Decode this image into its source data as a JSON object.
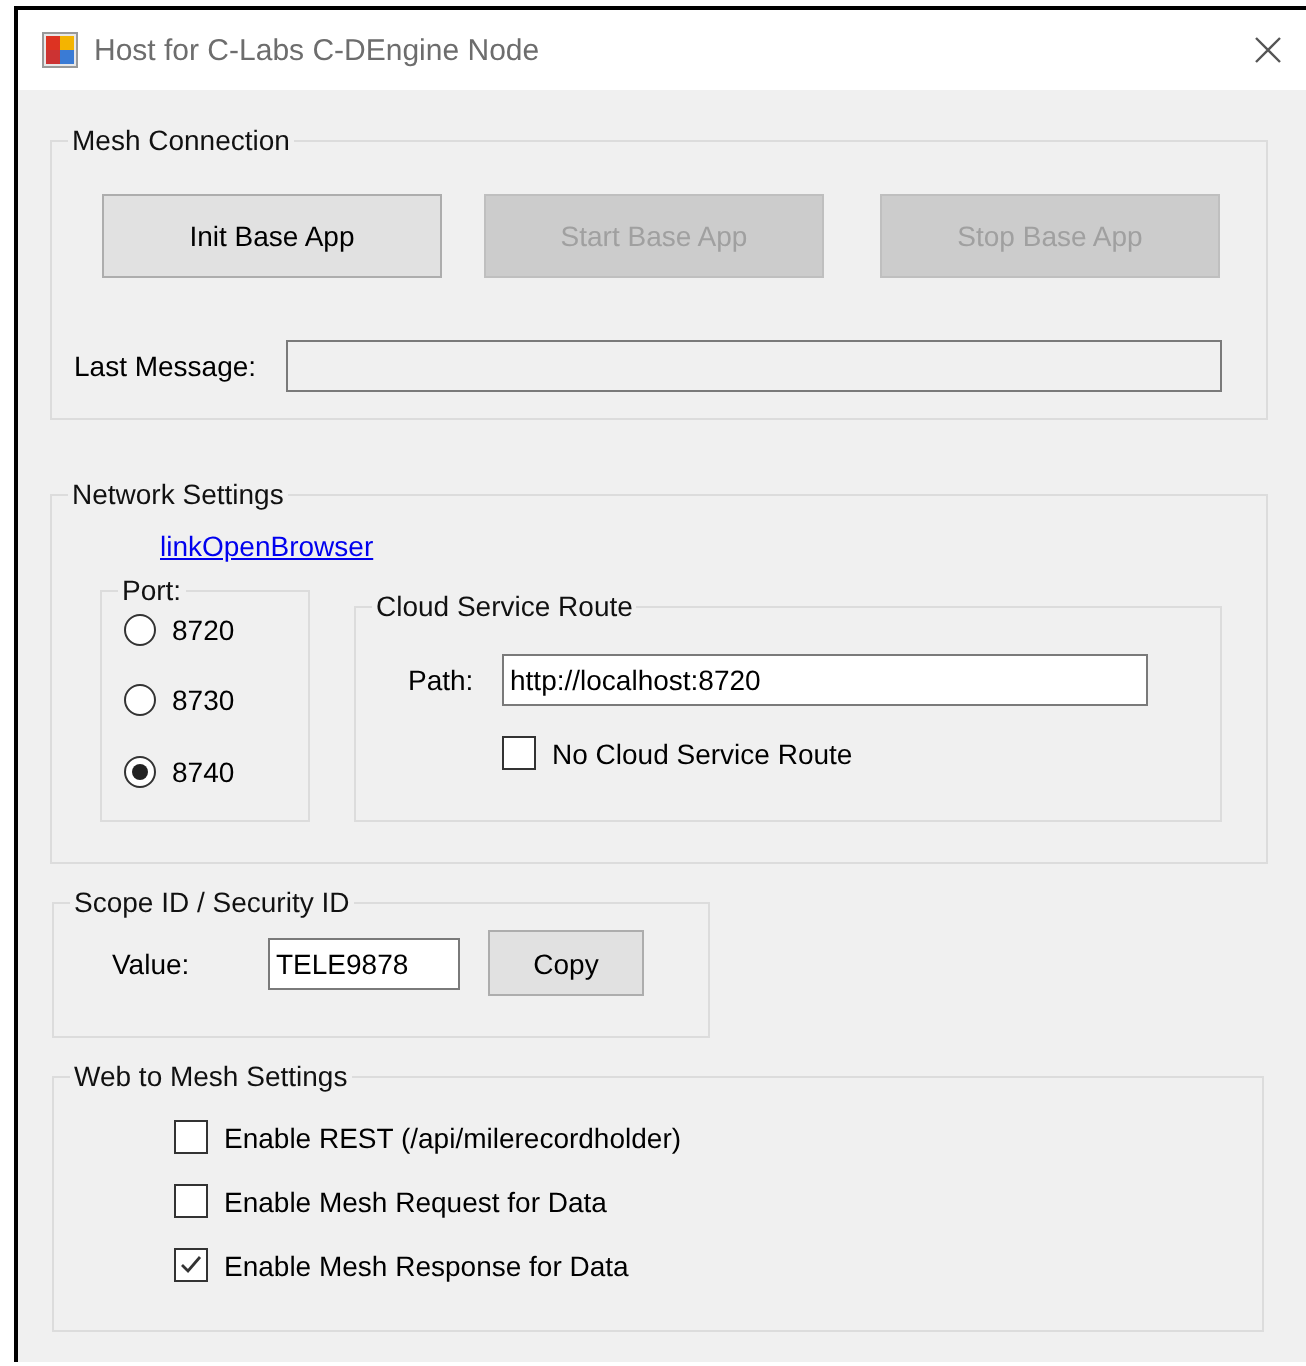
{
  "window": {
    "title": "Host for C-Labs C-DEngine Node"
  },
  "mesh_connection": {
    "title": "Mesh Connection",
    "buttons": [
      {
        "label": "Init Base App",
        "disabled": false
      },
      {
        "label": "Start Base App",
        "disabled": true
      },
      {
        "label": "Stop Base App",
        "disabled": true
      }
    ],
    "last_message": {
      "label": "Last Message:"
    }
  },
  "network_settings": {
    "title": "Network Settings",
    "link": "linkOpenBrowser",
    "port": {
      "title": "Port:",
      "options": [
        {
          "label": "8720",
          "selected": false
        },
        {
          "label": "8730",
          "selected": false
        },
        {
          "label": "8740",
          "selected": true
        }
      ]
    },
    "cloud_service_route": {
      "title": "Cloud Service Route",
      "path": {
        "label": "Path:",
        "value": "http://localhost:8720"
      },
      "no_route": {
        "label": "No Cloud Service Route",
        "checked": false
      }
    }
  },
  "scope_id": {
    "title": "Scope ID / Security ID",
    "value": {
      "label": "Value:",
      "value": "TELE9878"
    },
    "copy_button": {
      "label": "Copy",
      "disabled": false
    }
  },
  "web_to_mesh": {
    "title": "Web to Mesh Settings",
    "options": [
      {
        "label": "Enable REST (/api/milerecordholder)",
        "checked": false
      },
      {
        "label": "Enable Mesh Request for Data",
        "checked": false
      },
      {
        "label": "Enable Mesh Response for Data",
        "checked": true
      }
    ]
  }
}
